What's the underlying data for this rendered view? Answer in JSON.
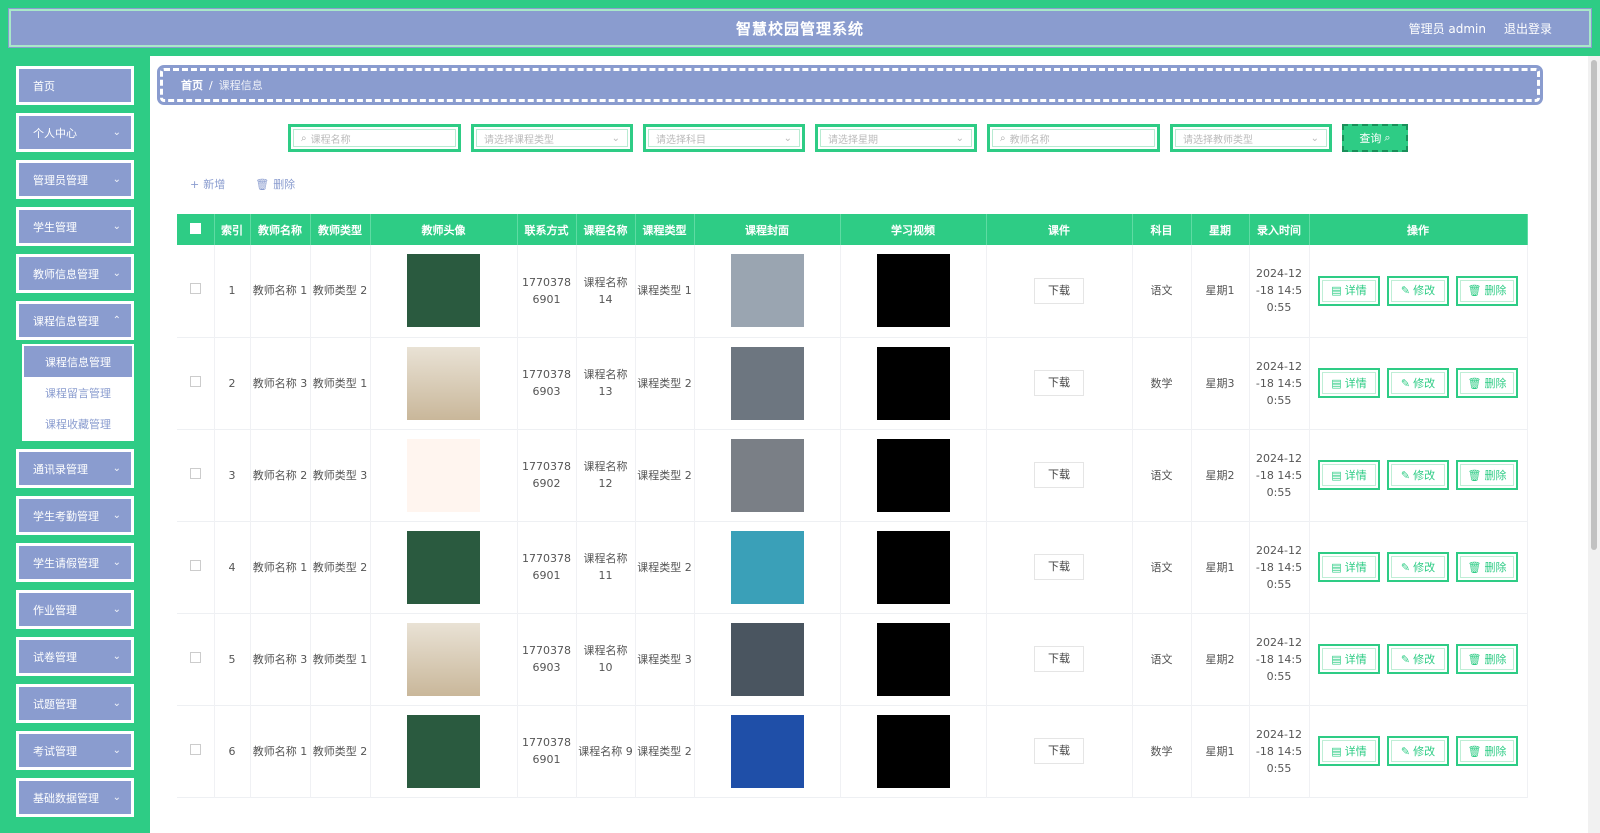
{
  "header": {
    "title": "智慧校园管理系统",
    "user": "管理员 admin",
    "logout": "退出登录"
  },
  "sidebar": {
    "items": [
      {
        "label": "首页",
        "chev": ""
      },
      {
        "label": "个人中心",
        "chev": "⌄"
      },
      {
        "label": "管理员管理",
        "chev": "⌄"
      },
      {
        "label": "学生管理",
        "chev": "⌄"
      },
      {
        "label": "教师信息管理",
        "chev": "⌄"
      },
      {
        "label": "课程信息管理",
        "chev": "⌃"
      }
    ],
    "submenu": [
      "课程信息管理",
      "课程留言管理",
      "课程收藏管理"
    ],
    "items2": [
      {
        "label": "通讯录管理",
        "chev": "⌄"
      },
      {
        "label": "学生考勤管理",
        "chev": "⌄"
      },
      {
        "label": "学生请假管理",
        "chev": "⌄"
      },
      {
        "label": "作业管理",
        "chev": "⌄"
      },
      {
        "label": "试卷管理",
        "chev": "⌄"
      },
      {
        "label": "试题管理",
        "chev": "⌄"
      },
      {
        "label": "考试管理",
        "chev": "⌄"
      },
      {
        "label": "基础数据管理",
        "chev": "⌄"
      }
    ]
  },
  "breadcrumb": {
    "home": "首页",
    "sep": "/",
    "current": "课程信息"
  },
  "filters": {
    "course_name": "课程名称",
    "course_type": "请选择课程类型",
    "subject": "请选择科目",
    "weekday": "请选择星期",
    "teacher_name": "教师名称",
    "teacher_type": "请选择教师类型",
    "query": "查询"
  },
  "actions": {
    "add": "新增",
    "delete": "删除"
  },
  "table": {
    "headers": [
      "",
      "索引",
      "教师名称",
      "教师类型",
      "教师头像",
      "联系方式",
      "课程名称",
      "课程类型",
      "课程封面",
      "学习视频",
      "课件",
      "科目",
      "星期",
      "录入时间",
      "操作"
    ],
    "download": "下载",
    "op_detail": "详情",
    "op_edit": "修改",
    "op_delete": "删除",
    "rows": [
      {
        "idx": "1",
        "tname": "教师名称 1",
        "ttype": "教师类型 2",
        "phone": "1770378 6901",
        "cname": "课程名称 14",
        "ctype": "课程类型 1",
        "subject": "语文",
        "week": "星期1",
        "time": "2024-12 -18 14:5 0:55"
      },
      {
        "idx": "2",
        "tname": "教师名称 3",
        "ttype": "教师类型 1",
        "phone": "1770378 6903",
        "cname": "课程名称 13",
        "ctype": "课程类型 2",
        "subject": "数学",
        "week": "星期3",
        "time": "2024-12 -18 14:5 0:55"
      },
      {
        "idx": "3",
        "tname": "教师名称 2",
        "ttype": "教师类型 3",
        "phone": "1770378 6902",
        "cname": "课程名称 12",
        "ctype": "课程类型 2",
        "subject": "语文",
        "week": "星期2",
        "time": "2024-12 -18 14:5 0:55"
      },
      {
        "idx": "4",
        "tname": "教师名称 1",
        "ttype": "教师类型 2",
        "phone": "1770378 6901",
        "cname": "课程名称 11",
        "ctype": "课程类型 2",
        "subject": "语文",
        "week": "星期1",
        "time": "2024-12 -18 14:5 0:55"
      },
      {
        "idx": "5",
        "tname": "教师名称 3",
        "ttype": "教师类型 1",
        "phone": "1770378 6903",
        "cname": "课程名称 10",
        "ctype": "课程类型 3",
        "subject": "语文",
        "week": "星期2",
        "time": "2024-12 -18 14:5 0:55"
      },
      {
        "idx": "6",
        "tname": "教师名称 1",
        "ttype": "教师类型 2",
        "phone": "1770378 6901",
        "cname": "课程名称 9",
        "ctype": "课程类型 2",
        "subject": "数学",
        "week": "星期1",
        "time": "2024-12 -18 14:5 0:55"
      }
    ]
  },
  "colors": {
    "accent": "#2ecc85",
    "brand": "#8a9ccf"
  }
}
